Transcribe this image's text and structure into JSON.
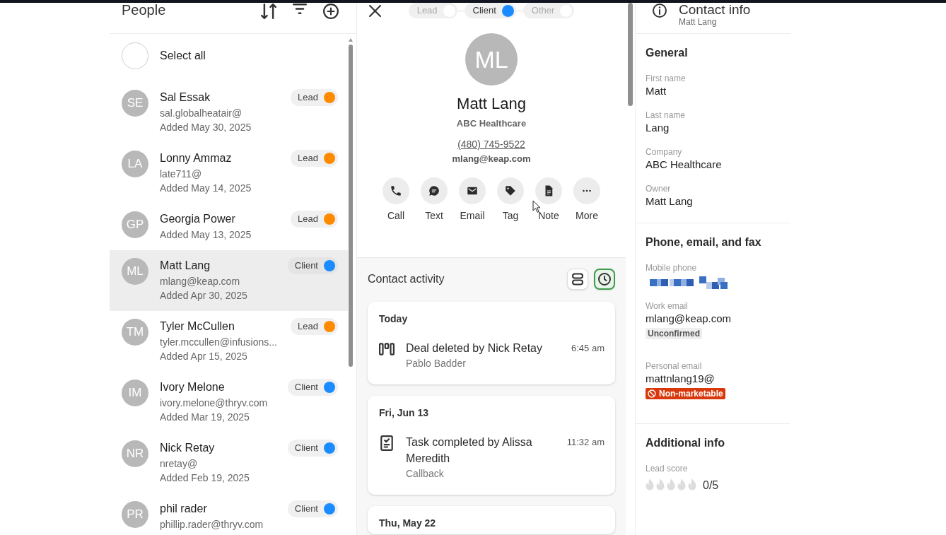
{
  "people_panel": {
    "title": "People",
    "select_all": {
      "label": "Select all",
      "checked": false
    },
    "contacts": [
      {
        "initials": "SE",
        "name": "Sal Essak",
        "email": "sal.globalheatair@",
        "added": "Added May 30, 2025",
        "type": "Lead",
        "color": "#ff8a00",
        "selected": false
      },
      {
        "initials": "LA",
        "name": "Lonny Ammaz",
        "email": "late711@",
        "added": "Added May 14, 2025",
        "type": "Lead",
        "color": "#ff8a00",
        "selected": false
      },
      {
        "initials": "GP",
        "name": "Georgia Power",
        "added": "Added May 13, 2025",
        "type": "Lead",
        "color": "#ff8a00",
        "selected": false
      },
      {
        "initials": "ML",
        "name": "Matt Lang",
        "email": "mlang@keap.com",
        "added": "Added Apr 30, 2025",
        "type": "Client",
        "color": "#1a8cff",
        "selected": true
      },
      {
        "initials": "TM",
        "name": "Tyler McCullen",
        "email": "tyler.mccullen@infusions...",
        "added": "Added Apr 15, 2025",
        "type": "Lead",
        "color": "#ff8a00",
        "selected": false
      },
      {
        "initials": "IM",
        "name": "Ivory Melone",
        "email": "ivory.melone@thryv.com",
        "added": "Added Mar 19, 2025",
        "type": "Client",
        "color": "#1a8cff",
        "selected": false
      },
      {
        "initials": "NR",
        "name": "Nick Retay",
        "email": "nretay@",
        "added": "Added Feb 19, 2025",
        "type": "Client",
        "color": "#1a8cff",
        "selected": false
      },
      {
        "initials": "PR",
        "name": "phil rader",
        "email": "phillip.rader@thryv.com",
        "type": "Client",
        "color": "#1a8cff",
        "selected": false
      }
    ]
  },
  "contact": {
    "stages": [
      {
        "label": "Lead",
        "selected": false
      },
      {
        "label": "Client",
        "selected": true
      },
      {
        "label": "Other",
        "selected": false
      }
    ],
    "initials": "ML",
    "name": "Matt Lang",
    "company": "ABC Healthcare",
    "phone": "(480) 745-9522",
    "email": "mlang@keap.com",
    "actions": [
      {
        "kind": "call",
        "label": "Call"
      },
      {
        "kind": "text",
        "label": "Text"
      },
      {
        "kind": "email",
        "label": "Email"
      },
      {
        "kind": "tag",
        "label": "Tag"
      },
      {
        "kind": "note",
        "label": "Note"
      },
      {
        "kind": "more",
        "label": "More"
      }
    ]
  },
  "activity": {
    "title": "Contact activity",
    "views": [
      {
        "kind": "list",
        "selected": false
      },
      {
        "kind": "timeline",
        "selected": true
      }
    ],
    "groups": [
      {
        "date": "Today",
        "items": [
          {
            "kind": "deal",
            "title": "Deal deleted by Nick Retay",
            "subtitle": "Pablo Badder",
            "time": "6:45 am"
          }
        ]
      },
      {
        "date": "Fri, Jun 13",
        "items": [
          {
            "kind": "task",
            "title": "Task completed by Alissa Meredith",
            "subtitle": "Callback",
            "time": "11:32 am"
          }
        ]
      },
      {
        "date": "Thu, May 22"
      }
    ]
  },
  "contact_info": {
    "title": "Contact info",
    "subtitle": "Matt Lang",
    "sections": [
      {
        "title": "General",
        "fields": [
          {
            "kind": "text",
            "label": "First name",
            "value": "Matt"
          },
          {
            "kind": "text",
            "label": "Last name",
            "value": "Lang"
          },
          {
            "kind": "text",
            "label": "Company",
            "value": "ABC Healthcare"
          },
          {
            "kind": "text",
            "label": "Owner",
            "value": "Matt Lang"
          }
        ]
      },
      {
        "title": "Phone, email, and fax",
        "fields": [
          {
            "kind": "obscured",
            "label": "Mobile phone"
          },
          {
            "kind": "text",
            "label": "Work email",
            "value": "mlang@keap.com",
            "badge": {
              "kind": "neutral",
              "text": "Unconfirmed"
            }
          },
          {
            "kind": "text",
            "label": "Personal email",
            "value": "mattnlang19@",
            "badge": {
              "kind": "danger",
              "text": "Non-marketable"
            }
          }
        ]
      },
      {
        "title": "Additional info",
        "fields": [
          {
            "kind": "score",
            "label": "Lead score",
            "stars": 0,
            "reading": "0/5"
          }
        ]
      }
    ]
  }
}
